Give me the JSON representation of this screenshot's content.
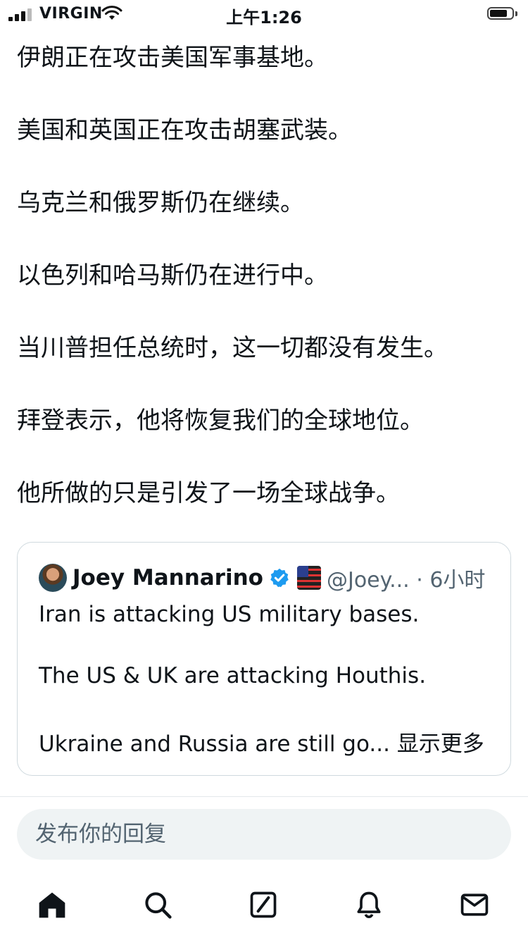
{
  "status_bar": {
    "carrier": "VIRGIN",
    "time": "上午1:26"
  },
  "post": {
    "lines": [
      "伊朗正在攻击美国军事基地。",
      "美国和英国正在攻击胡塞武装。",
      "乌克兰和俄罗斯仍在继续。",
      "以色列和哈马斯仍在进行中。",
      "当川普担任总统时，这一切都没有发生。",
      "拜登表示，他将恢复我们的全球地位。",
      "他所做的只是引发了一场全球战争。"
    ]
  },
  "quote": {
    "author_name": "Joey Mannarino",
    "handle": "@Joey... · 6小时",
    "lines": [
      "Iran is attacking US military bases.",
      "The US & UK are attacking Houthis.",
      "Ukraine and Russia are still go..."
    ],
    "show_more": "显示更多"
  },
  "reply": {
    "placeholder": "发布你的回复"
  },
  "nav": {
    "items": [
      "home-icon",
      "search-icon",
      "compose-icon",
      "notifications-icon",
      "messages-icon"
    ]
  },
  "colors": {
    "text": "#0f1419",
    "secondary": "#536471",
    "verified": "#1d9bf0",
    "border": "#cfd9de"
  }
}
